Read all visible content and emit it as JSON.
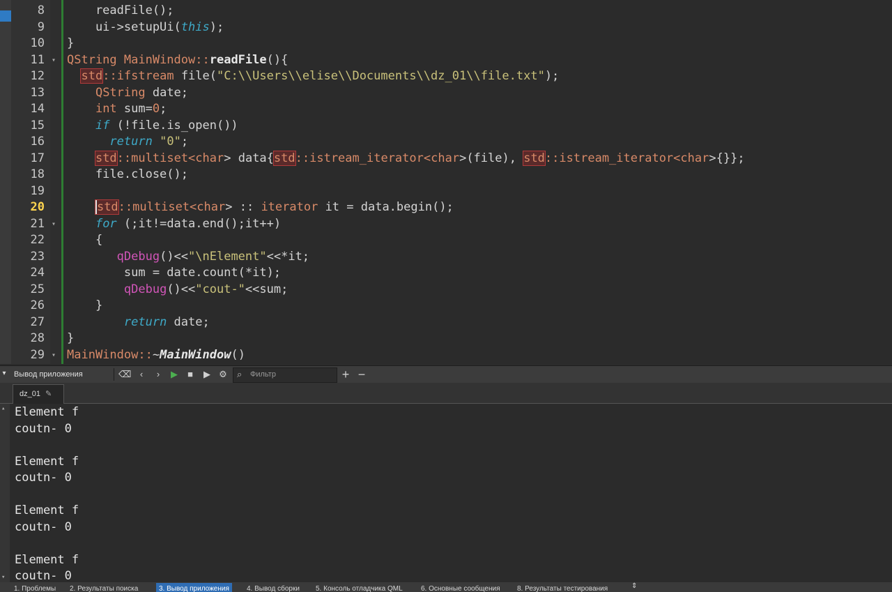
{
  "editor": {
    "current_line": "20",
    "lines": [
      {
        "num": "8",
        "segments": [
          [
            "    readFile();",
            ""
          ]
        ]
      },
      {
        "num": "9",
        "segments": [
          [
            "    ui->setupUi(",
            ""
          ],
          [
            "this",
            "kw-i"
          ],
          [
            ");",
            ""
          ]
        ]
      },
      {
        "num": "10",
        "segments": [
          [
            "}",
            ""
          ]
        ]
      },
      {
        "num": "11",
        "fold": true,
        "segments": [
          [
            "QString ",
            "ty"
          ],
          [
            "MainWindow",
            "ty"
          ],
          [
            "::",
            "ty"
          ],
          [
            "readFile",
            "fn"
          ],
          [
            "(){",
            ""
          ]
        ]
      },
      {
        "num": "12",
        "segments": [
          [
            "  ",
            ""
          ],
          [
            "std",
            "ty hl"
          ],
          [
            "::",
            "ty"
          ],
          [
            "ifstream",
            "ty"
          ],
          [
            " file(",
            ""
          ],
          [
            "\"C:\\\\Users\\\\elise\\\\Documents\\\\dz_01\\\\file.txt\"",
            "str"
          ],
          [
            ");",
            ""
          ]
        ]
      },
      {
        "num": "13",
        "segments": [
          [
            "    ",
            ""
          ],
          [
            "QString",
            "ty"
          ],
          [
            " date;",
            ""
          ]
        ]
      },
      {
        "num": "14",
        "segments": [
          [
            "    ",
            ""
          ],
          [
            "int",
            "ty"
          ],
          [
            " sum=",
            ""
          ],
          [
            "0",
            "num"
          ],
          [
            ";",
            ""
          ]
        ]
      },
      {
        "num": "15",
        "segments": [
          [
            "    ",
            ""
          ],
          [
            "if",
            "kw-i"
          ],
          [
            " (!file.is_open())",
            ""
          ]
        ]
      },
      {
        "num": "16",
        "segments": [
          [
            "      ",
            ""
          ],
          [
            "return",
            "kw-i"
          ],
          [
            " ",
            ""
          ],
          [
            "\"0\"",
            "str"
          ],
          [
            ";",
            ""
          ]
        ]
      },
      {
        "num": "17",
        "segments": [
          [
            "    ",
            ""
          ],
          [
            "std",
            "ty hl"
          ],
          [
            "::",
            "ty"
          ],
          [
            "multiset",
            "ty"
          ],
          [
            "<",
            "ty"
          ],
          [
            "char",
            "ty"
          ],
          [
            "> data{",
            ""
          ],
          [
            "std",
            "ty hl"
          ],
          [
            "::",
            "ty"
          ],
          [
            "istream_iterator",
            "ty"
          ],
          [
            "<",
            "ty"
          ],
          [
            "char",
            "ty"
          ],
          [
            ">(file), ",
            ""
          ],
          [
            "std",
            "ty hl"
          ],
          [
            "::",
            "ty"
          ],
          [
            "istream_iterator",
            "ty"
          ],
          [
            "<",
            "ty"
          ],
          [
            "char",
            "ty"
          ],
          [
            ">{}};",
            ""
          ]
        ]
      },
      {
        "num": "18",
        "segments": [
          [
            "    file.close();",
            ""
          ]
        ]
      },
      {
        "num": "19",
        "segments": [
          [
            "",
            ""
          ]
        ]
      },
      {
        "num": "20",
        "segments": [
          [
            "    ",
            ""
          ],
          [
            "std",
            "ty hl caret"
          ],
          [
            "::",
            "ty"
          ],
          [
            "multiset",
            "ty"
          ],
          [
            "<",
            "ty"
          ],
          [
            "char",
            "ty"
          ],
          [
            "> :: ",
            ""
          ],
          [
            "iterator",
            "ty"
          ],
          [
            " it = data.begin();",
            ""
          ]
        ]
      },
      {
        "num": "21",
        "fold": true,
        "segments": [
          [
            "    ",
            ""
          ],
          [
            "for",
            "kw-i"
          ],
          [
            " (;it!=data.end();it++)",
            ""
          ]
        ]
      },
      {
        "num": "22",
        "segments": [
          [
            "    {",
            ""
          ]
        ]
      },
      {
        "num": "23",
        "segments": [
          [
            "       ",
            ""
          ],
          [
            "qDebug",
            "mac"
          ],
          [
            "()<<",
            ""
          ],
          [
            "\"\\nElement\"",
            "str"
          ],
          [
            "<<*it;",
            ""
          ]
        ]
      },
      {
        "num": "24",
        "segments": [
          [
            "        sum = date.count(*it);",
            ""
          ]
        ]
      },
      {
        "num": "25",
        "segments": [
          [
            "        ",
            ""
          ],
          [
            "qDebug",
            "mac"
          ],
          [
            "()<<",
            ""
          ],
          [
            "\"cout-\"",
            "str"
          ],
          [
            "<<sum;",
            ""
          ]
        ]
      },
      {
        "num": "26",
        "segments": [
          [
            "    }",
            ""
          ]
        ]
      },
      {
        "num": "27",
        "segments": [
          [
            "        ",
            ""
          ],
          [
            "return",
            "kw-i"
          ],
          [
            " date;",
            ""
          ]
        ]
      },
      {
        "num": "28",
        "segments": [
          [
            "}",
            ""
          ]
        ]
      },
      {
        "num": "29",
        "fold": true,
        "segments": [
          [
            "MainWindow",
            "ty"
          ],
          [
            "::",
            "ty"
          ],
          [
            "~",
            ""
          ],
          [
            "MainWindow",
            "fn-i"
          ],
          [
            "()",
            ""
          ]
        ]
      }
    ]
  },
  "panel": {
    "title": "Вывод приложения",
    "filter_placeholder": "Фильтр",
    "tab_label": "dz_01",
    "icons": [
      "broom-icon",
      "chevron-left-icon",
      "chevron-right-icon",
      "run-icon",
      "stop-icon",
      "debug-run-icon",
      "gear-icon"
    ]
  },
  "output": {
    "lines": [
      "Element f",
      "coutn- 0",
      "",
      "Element f",
      "coutn- 0",
      "",
      "Element f",
      "coutn- 0",
      "",
      "Element f",
      "coutn- 0"
    ]
  },
  "statusbar": {
    "items": [
      {
        "label": "1. Проблемы"
      },
      {
        "label": "2. Результаты поиска"
      },
      {
        "label": "3. Вывод приложения",
        "active": true
      },
      {
        "label": "4. Вывод сборки"
      },
      {
        "label": "5. Консоль отладчика QML"
      },
      {
        "label": "6. Основные сообщения"
      },
      {
        "label": "8. Результаты тестирования"
      }
    ]
  }
}
